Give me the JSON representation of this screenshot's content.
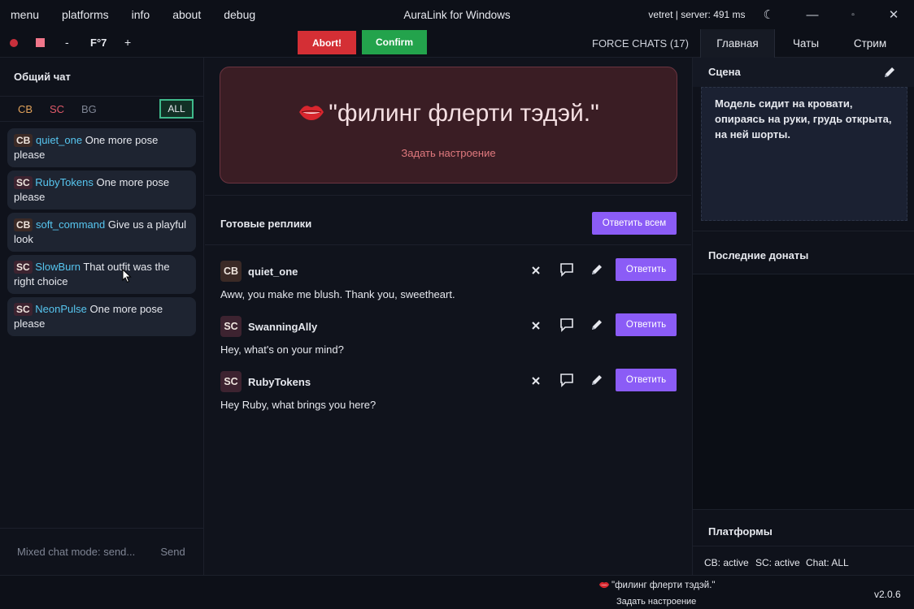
{
  "titlebar": {
    "menu": [
      "menu",
      "platforms",
      "info",
      "about",
      "debug"
    ],
    "app_title": "AuraLink for Windows",
    "user_status": "vetret  |  server: 491 ms"
  },
  "toolbar": {
    "font_size_minus": "-",
    "font_size_label": "F°7",
    "font_size_plus": "+",
    "abort_label": "Abort!",
    "confirm_label": "Confirm",
    "force_chats": "FORCE CHATS (17)",
    "tabs": [
      "Главная",
      "Чаты",
      "Стрим"
    ]
  },
  "left_panel": {
    "title": "Общий чат",
    "filters": {
      "cb": "CB",
      "sc": "SC",
      "bg": "BG",
      "all": "ALL"
    },
    "messages": [
      {
        "tag": "CB",
        "user": "quiet_one",
        "text": "One more pose please"
      },
      {
        "tag": "SC",
        "user": "RubyTokens",
        "text": "One more pose please"
      },
      {
        "tag": "CB",
        "user": "soft_command",
        "text": "Give us a playful look"
      },
      {
        "tag": "SC",
        "user": "SlowBurn",
        "text": "That outfit was the right choice"
      },
      {
        "tag": "SC",
        "user": "NeonPulse",
        "text": "One more pose please"
      }
    ],
    "input_placeholder": "Mixed chat mode: send...",
    "send_label": "Send"
  },
  "center": {
    "mood_text": "\"филинг флерти тэдэй.\"",
    "mood_action": "Задать настроение",
    "replies_title": "Готовые реплики",
    "reply_all_label": "Ответить всем",
    "replies": [
      {
        "tag": "CB",
        "user": "quiet_one",
        "text": "Aww, you make me blush. Thank you, sweetheart.",
        "button": "Ответить"
      },
      {
        "tag": "SC",
        "user": "SwanningAlly",
        "text": "Hey, what's on your mind?",
        "button": "Ответить"
      },
      {
        "tag": "SC",
        "user": "RubyTokens",
        "text": "Hey Ruby, what brings you here?",
        "button": "Ответить"
      }
    ]
  },
  "right_panel": {
    "scene_title": "Сцена",
    "scene_text": "Модель сидит на кровати, опираясь на руки, грудь открыта, на ней шорты.",
    "donations_title": "Последние донаты",
    "platforms_title": "Платформы",
    "platform_status": {
      "cb": "CB: active",
      "sc": "SC: active",
      "chat": "Chat: ALL"
    }
  },
  "footer": {
    "mood_text": "\"филинг флерти тэдэй.\"",
    "mood_action": "Задать настроение",
    "version": "v2.0.6"
  },
  "colors": {
    "accent_purple": "#8b5cf6",
    "abort_red": "#d42f35",
    "confirm_green": "#23a34c",
    "username_blue": "#57c6f0",
    "mood_card_bg": "#3a1d24"
  }
}
